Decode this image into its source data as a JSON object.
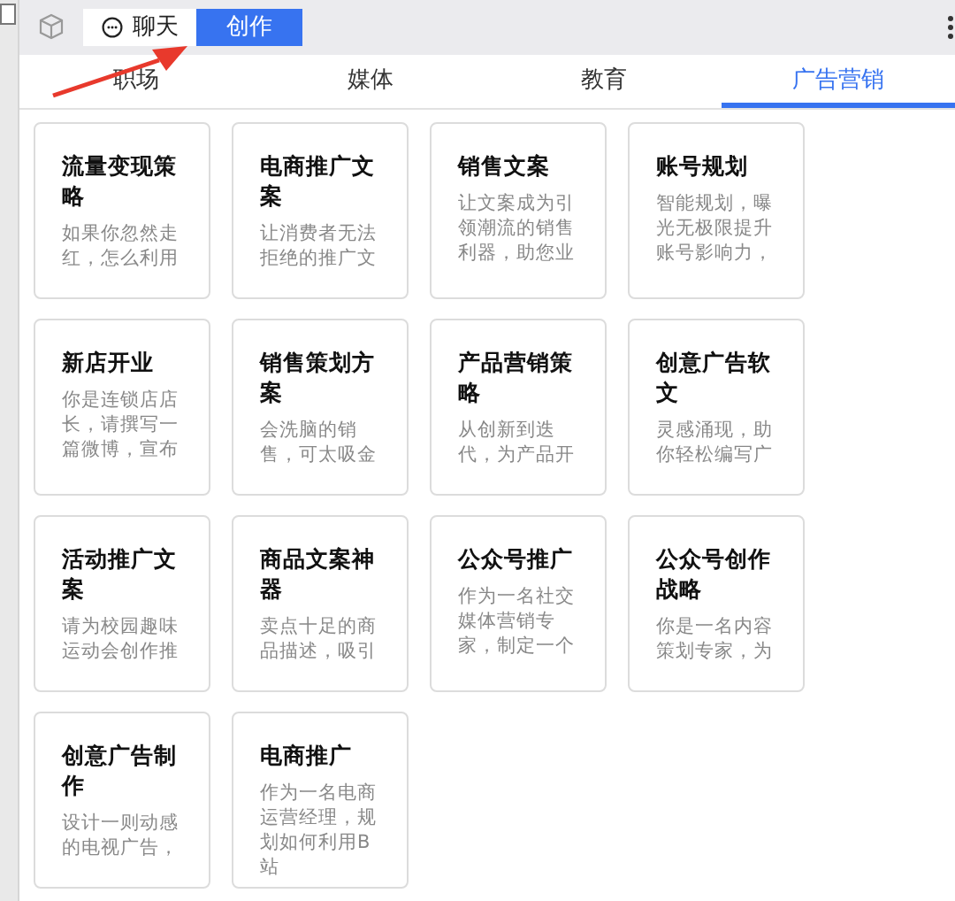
{
  "mode_tabs": [
    {
      "label": "聊天",
      "kind": "chat",
      "selected": false
    },
    {
      "label": "创作",
      "kind": "plain",
      "selected": true
    }
  ],
  "category_tabs": [
    {
      "label": "职场",
      "selected": false
    },
    {
      "label": "媒体",
      "selected": false
    },
    {
      "label": "教育",
      "selected": false
    },
    {
      "label": "广告营销",
      "selected": true
    }
  ],
  "cards": [
    {
      "title": "流量变现策略",
      "description": "如果你忽然走红，怎么利用"
    },
    {
      "title": "电商推广文案",
      "description": "让消费者无法拒绝的推广文"
    },
    {
      "title": "销售文案",
      "description": "让文案成为引领潮流的销售利器，助您业"
    },
    {
      "title": "账号规划",
      "description": "智能规划，曝光无极限提升账号影响力，"
    },
    {
      "title": "新店开业",
      "description": "你是连锁店店长，请撰写一篇微博，宣布"
    },
    {
      "title": "销售策划方案",
      "description": "会洗脑的销售，可太吸金"
    },
    {
      "title": "产品营销策略",
      "description": "从创新到迭代，为产品开"
    },
    {
      "title": "创意广告软文",
      "description": "灵感涌现，助你轻松编写广"
    },
    {
      "title": "活动推广文案",
      "description": "请为校园趣味运动会创作推"
    },
    {
      "title": "商品文案神器",
      "description": "卖点十足的商品描述，吸引"
    },
    {
      "title": "公众号推广",
      "description": "作为一名社交媒体营销专家，制定一个"
    },
    {
      "title": "公众号创作战略",
      "description": "你是一名内容策划专家，为"
    },
    {
      "title": "创意广告制作",
      "description": "设计一则动感的电视广告，"
    },
    {
      "title": "电商推广",
      "description": "作为一名电商运营经理，规划如何利用B站"
    }
  ]
}
